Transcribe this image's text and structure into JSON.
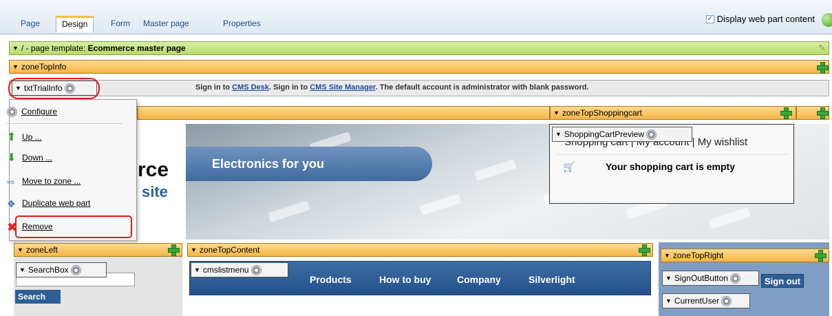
{
  "tabs": [
    {
      "label": "Page"
    },
    {
      "label": "Design",
      "active": true
    },
    {
      "label": "Form"
    },
    {
      "label": "Master page"
    },
    {
      "label": "Properties"
    }
  ],
  "display_web_part_content": {
    "label": "Display web part content",
    "checked": true
  },
  "template_bar": {
    "prefix": "/ - page template: ",
    "name": "Ecommerce master page"
  },
  "zones": {
    "top_info": "zoneTopInfo",
    "top_shopping_cart": "zoneTopShoppingcart",
    "left": "zoneLeft",
    "top_content": "zoneTopContent",
    "top_right": "zoneTopRight"
  },
  "web_parts": {
    "trial_info": "txtTrialInfo",
    "shopping_cart_preview": "ShoppingCartPreview",
    "search_box": "SearchBox",
    "cms_list_menu": "cmslistmenu",
    "sign_out_button": "SignOutButton",
    "current_user": "CurrentUser"
  },
  "trial_message": {
    "part1": "Sign in to ",
    "link1": "CMS Desk",
    "part2": ". Sign in to ",
    "link2": "CMS Site Manager",
    "part3": ". The default account is administrator with blank password."
  },
  "context_menu": {
    "configure": "Configure",
    "up": "Up ...",
    "down": "Down ...",
    "move_to_zone": "Move to zone ...",
    "duplicate": "Duplicate web part",
    "remove": "Remove"
  },
  "banner": {
    "tagline": "Electronics for you",
    "logo_line1": "rce",
    "logo_line2": "site"
  },
  "cart": {
    "links": "Shopping cart | My account | My wishlist",
    "empty_message": "Your shopping cart is empty"
  },
  "search": {
    "button_label": "Search",
    "input_value": ""
  },
  "menu_items": [
    "Products",
    "How to buy",
    "Company",
    "Silverlight"
  ],
  "sign_out_label": "Sign out",
  "icons": {
    "zone_collapse": "triangle-down-icon",
    "add_web_part": "green-plus-icon",
    "web_part_settings": "gear-icon",
    "edit_template": "pencil-icon",
    "globe": "globe-icon"
  }
}
